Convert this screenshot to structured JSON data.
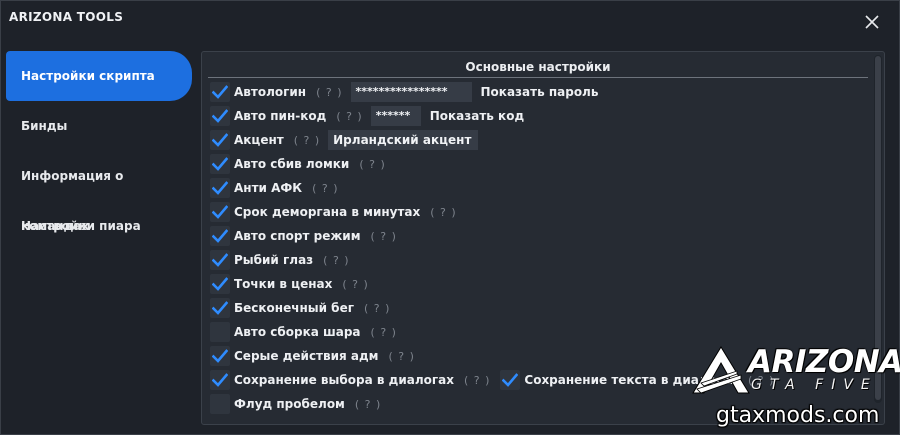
{
  "window": {
    "title": "ARIZONA TOOLS"
  },
  "sidebar": {
    "items": [
      {
        "label": "Настройки скрипта",
        "active": true
      },
      {
        "label": "Бинды",
        "active": false
      },
      {
        "label": "Информация о командах",
        "active": false
      },
      {
        "label": "Настройки пиара",
        "active": false
      }
    ]
  },
  "panel": {
    "title": "Основные настройки",
    "help": "( ? )",
    "rows": [
      {
        "label": "Автологин",
        "checked": true,
        "field": "****************",
        "link": "Показать пароль"
      },
      {
        "label": "Авто пин-код",
        "checked": true,
        "field": "******",
        "link": "Показать код"
      },
      {
        "label": "Акцент",
        "checked": true,
        "field": "Ирландский акцент"
      },
      {
        "label": "Авто сбив ломки",
        "checked": true
      },
      {
        "label": "Анти АФК",
        "checked": true
      },
      {
        "label": "Срок деморгана в минутах",
        "checked": true
      },
      {
        "label": "Авто спорт режим",
        "checked": true
      },
      {
        "label": "Рыбий глаз",
        "checked": true
      },
      {
        "label": "Точки в ценах",
        "checked": true
      },
      {
        "label": "Бесконечный бег",
        "checked": true
      },
      {
        "label": "Авто сборка шара",
        "checked": false
      },
      {
        "label": "Серые действия адм",
        "checked": true
      },
      {
        "label": "Сохранение выбора в диалогах",
        "checked": true,
        "extra_label": "Сохранение текста в диалогах",
        "extra_checked": true
      },
      {
        "label": "Флуд пробелом",
        "checked": false
      }
    ]
  },
  "watermark": {
    "logo": "ARIZONA",
    "logo_sub": "GTA FIVE",
    "site": "gtaxmods.com"
  },
  "colors": {
    "accent": "#1d6fe0",
    "check": "#2f8cff",
    "background": "#1e2229",
    "panel": "#262b33"
  },
  "icons": {
    "close": "close-icon",
    "check": "check-icon"
  }
}
